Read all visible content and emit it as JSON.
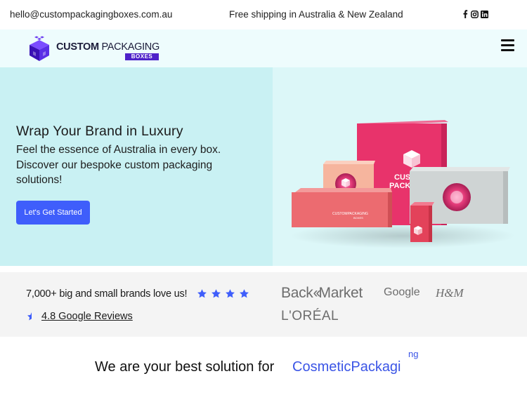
{
  "topbar": {
    "email": "hello@custompackagingboxes.com.au",
    "shipping": "Free shipping in Australia & New Zealand",
    "social_icons": [
      "facebook-icon",
      "instagram-icon",
      "linkedin-icon"
    ]
  },
  "header": {
    "logo_line1_bold": "CUSTOM",
    "logo_line1_rest": "PACKAGING",
    "logo_line2": "BOXES"
  },
  "hero": {
    "title": "Wrap Your Brand in Luxury",
    "subtitle": "Feel the essence of Australia in every box. Discover our bespoke custom packaging solutions!",
    "cta": "Let's Get Started",
    "box_label_big": "CUSTOM PACKAGING",
    "box_label_small": "CUSTOMPACKAGING BOXES"
  },
  "trust": {
    "brands_love": "7,000+ big and small brands love us!",
    "rating_stars": 4,
    "reviews_link": "4.8 Google Reviews",
    "brands": [
      "BackMarket",
      "Google",
      "H&M",
      "L'ORÉAL"
    ]
  },
  "solution": {
    "lead": "We are your best solution for",
    "highlight": "CosmeticPackagi",
    "ghost": "ng"
  },
  "colors": {
    "accent": "#3f5efb",
    "hero_bg": "#c9f1f3",
    "header_bg": "#eefcfd",
    "box_pink": "#e8336b",
    "logo_purple": "#4d21c9"
  }
}
